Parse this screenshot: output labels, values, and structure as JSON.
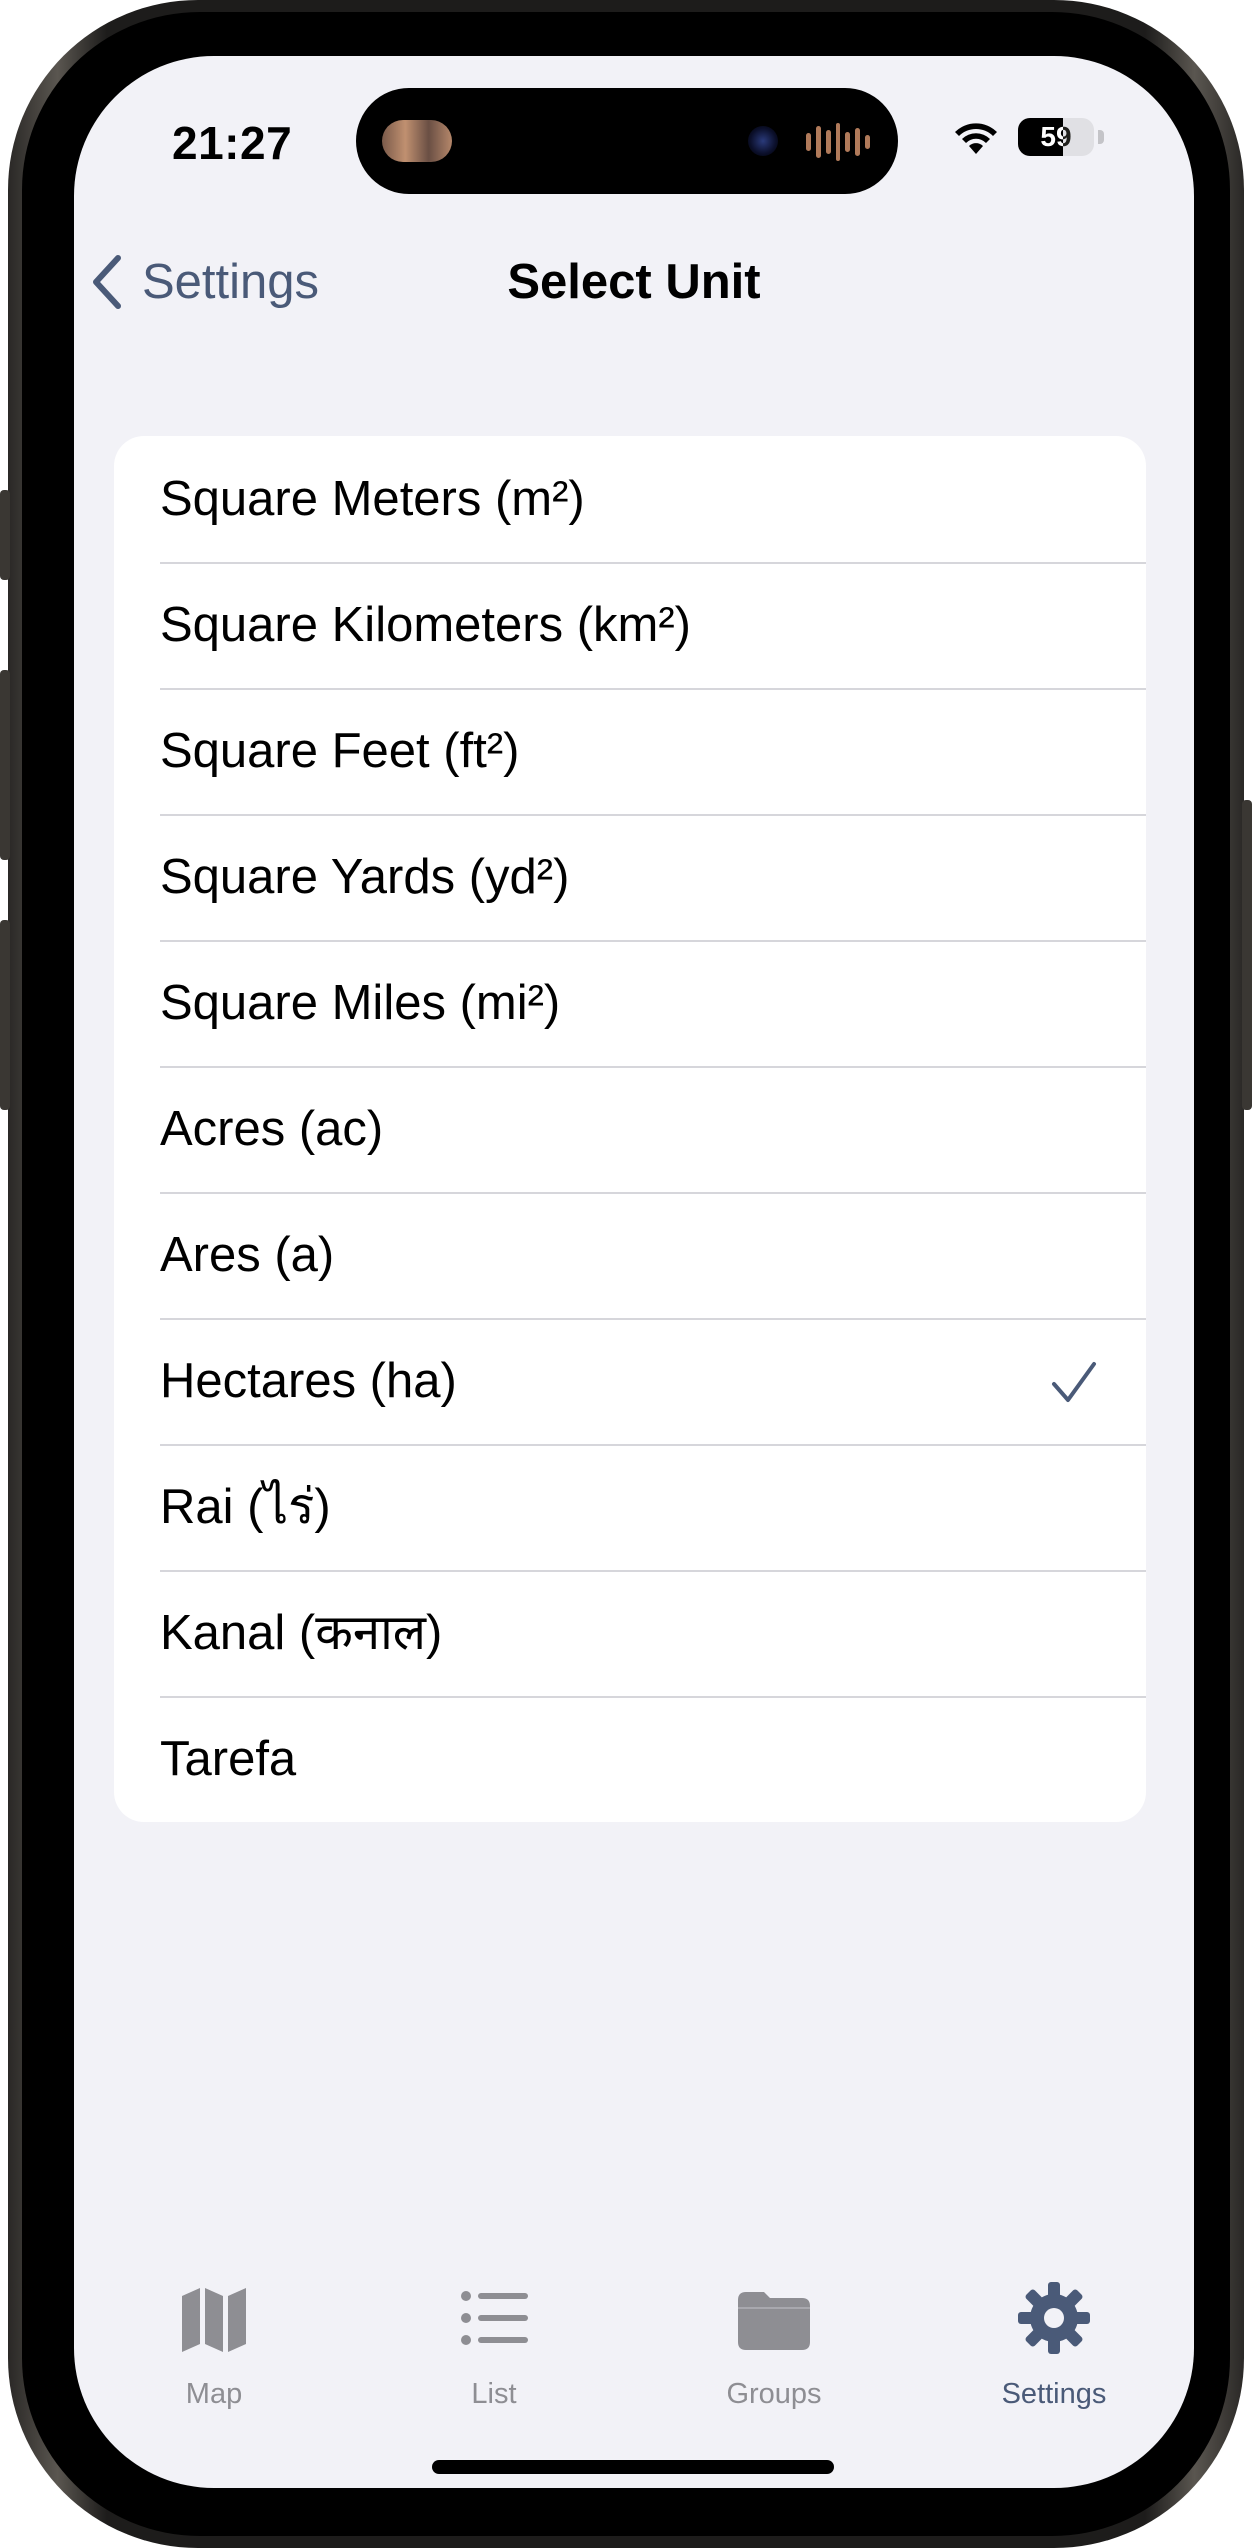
{
  "status_bar": {
    "time": "21:27",
    "battery": "59"
  },
  "nav": {
    "back_label": "Settings",
    "title": "Select Unit"
  },
  "units": [
    {
      "label": "Square Meters (m²)",
      "selected": false
    },
    {
      "label": "Square Kilometers (km²)",
      "selected": false
    },
    {
      "label": "Square Feet (ft²)",
      "selected": false
    },
    {
      "label": "Square Yards (yd²)",
      "selected": false
    },
    {
      "label": "Square Miles (mi²)",
      "selected": false
    },
    {
      "label": "Acres (ac)",
      "selected": false
    },
    {
      "label": "Ares (a)",
      "selected": false
    },
    {
      "label": "Hectares (ha)",
      "selected": true
    },
    {
      "label": "Rai (ไร่)",
      "selected": false
    },
    {
      "label": "Kanal (कनाल)",
      "selected": false
    },
    {
      "label": "Tarefa",
      "selected": false
    }
  ],
  "tabs": [
    {
      "label": "Map",
      "icon": "map-icon",
      "active": false
    },
    {
      "label": "List",
      "icon": "list-icon",
      "active": false
    },
    {
      "label": "Groups",
      "icon": "folder-icon",
      "active": false
    },
    {
      "label": "Settings",
      "icon": "gear-icon",
      "active": true
    }
  ],
  "colors": {
    "accent": "#4a5a78",
    "inactive": "#8e8e93",
    "background": "#f2f2f7"
  }
}
